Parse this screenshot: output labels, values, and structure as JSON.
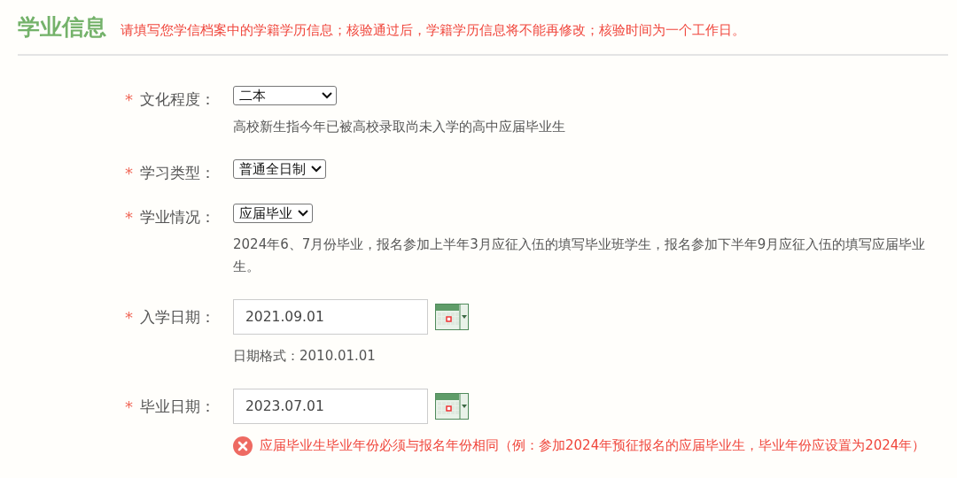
{
  "section": {
    "title": "学业信息",
    "notice": "请填写您学信档案中的学籍学历信息；核验通过后，学籍学历信息将不能再修改；核验时间为一个工作日。"
  },
  "fields": [
    {
      "kind": "select",
      "required_mark": "*",
      "label": "文化程度：",
      "value": "二本",
      "hint": "高校新生指今年已被高校录取尚未入学的高中应届毕业生"
    },
    {
      "kind": "select",
      "required_mark": "*",
      "label": "学习类型：",
      "value": "普通全日制"
    },
    {
      "kind": "select",
      "required_mark": "*",
      "label": "学业情况：",
      "value": "应届毕业",
      "hint": "2024年6、7月份毕业，报名参加上半年3月应征入伍的填写毕业班学生，报名参加下半年9月应征入伍的填写应届毕业生。"
    },
    {
      "kind": "date",
      "required_mark": "*",
      "label": "入学日期：",
      "value": "2021.09.01",
      "hint": "日期格式：2010.01.01"
    },
    {
      "kind": "date",
      "required_mark": "*",
      "label": "毕业日期：",
      "value": "2023.07.01",
      "error": "应届毕业生毕业年份必须与报名年份相同（例：参加2024年预征报名的应届毕业生，毕业年份应设置为2024年）"
    }
  ]
}
